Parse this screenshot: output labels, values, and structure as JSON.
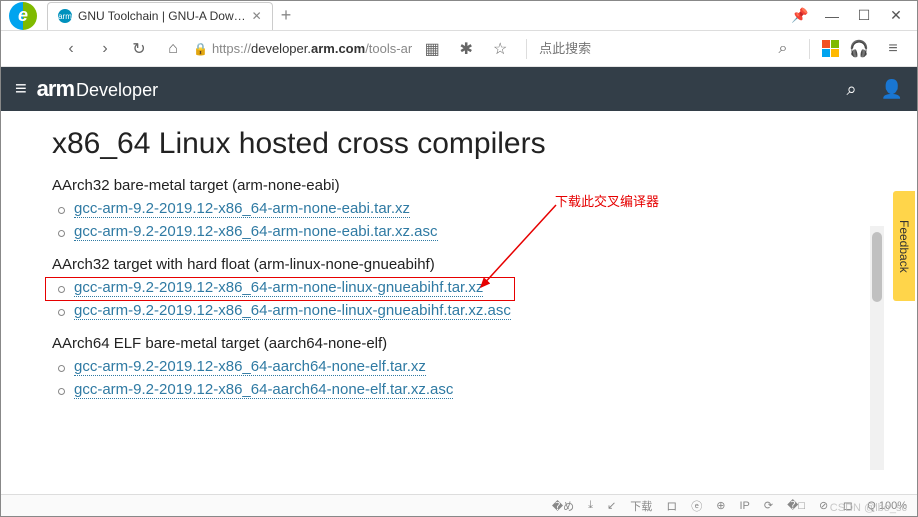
{
  "window": {
    "tab_title": "GNU Toolchain | GNU-A Dow…",
    "pin_icon": "📌",
    "min": "—",
    "max": "☐",
    "close": "✕",
    "new_tab": "+"
  },
  "toolbar": {
    "back": "‹",
    "forward": "›",
    "reload": "↻",
    "home": "⌂",
    "lock": "🔒",
    "url_prefix": "https://",
    "url_host_pre": "developer.",
    "url_host_bold": "arm.com",
    "url_path": "/tools-ar",
    "qr": "▦",
    "ext": "✱",
    "star": "☆",
    "search_placeholder": "点此搜索",
    "search_icon": "⌕",
    "headphones": "🎧",
    "menu": "≡"
  },
  "site_header": {
    "menu": "≡",
    "brand_bold": "arm",
    "brand_light": "Developer",
    "search": "⌕",
    "account": "👤"
  },
  "page": {
    "title": "x86_64 Linux hosted cross compilers",
    "sections": [
      {
        "heading": "AArch32 bare-metal target (arm-none-eabi)",
        "links": [
          "gcc-arm-9.2-2019.12-x86_64-arm-none-eabi.tar.xz",
          "gcc-arm-9.2-2019.12-x86_64-arm-none-eabi.tar.xz.asc"
        ]
      },
      {
        "heading": "AArch32 target with hard float (arm-linux-none-gnueabihf)",
        "links": [
          "gcc-arm-9.2-2019.12-x86_64-arm-none-linux-gnueabihf.tar.xz",
          "gcc-arm-9.2-2019.12-x86_64-arm-none-linux-gnueabihf.tar.xz.asc"
        ]
      },
      {
        "heading": "AArch64 ELF bare-metal target (aarch64-none-elf)",
        "links": [
          "gcc-arm-9.2-2019.12-x86_64-aarch64-none-elf.tar.xz",
          "gcc-arm-9.2-2019.12-x86_64-aarch64-none-elf.tar.xz.asc"
        ]
      }
    ],
    "callout": "下载此交叉编译器",
    "feedback": "Feedback"
  },
  "status": {
    "items": [
      "�め",
      "⤓",
      "↙",
      "下载",
      "ロ",
      "ⓔ",
      "⊕",
      "IP",
      "⟳",
      "�□",
      "⊘",
      "ロ",
      "Q 100%"
    ]
  },
  "watermark": "CSDN @lbo_sc"
}
